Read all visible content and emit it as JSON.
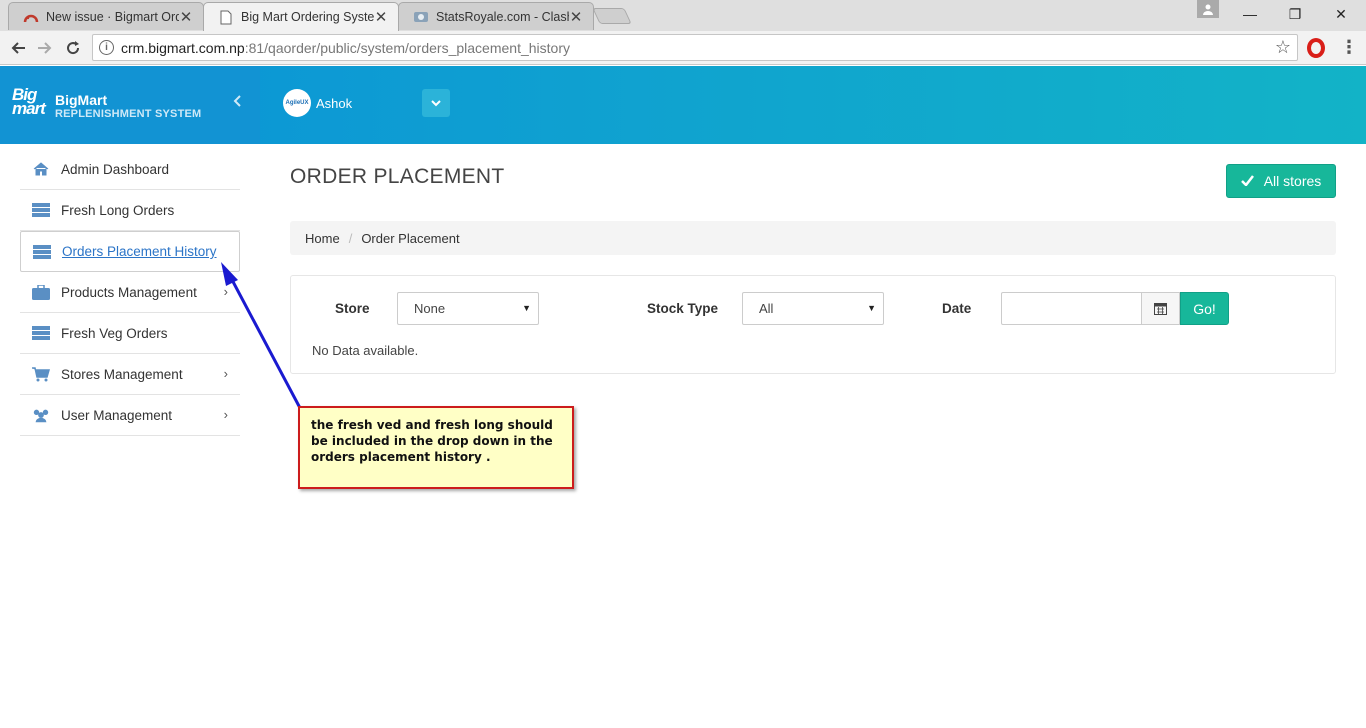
{
  "browser": {
    "tabs": [
      {
        "title": "New issue · Bigmart Orde",
        "close": "✕"
      },
      {
        "title": "Big Mart Ordering System",
        "close": "✕"
      },
      {
        "title": "StatsRoyale.com - Clash R",
        "close": "✕"
      }
    ],
    "url_host": "crm.bigmart.com.np",
    "url_path": ":81/qaorder/public/system/orders_placement_history",
    "window_controls": {
      "minimize": "—",
      "restore": "❐",
      "close": "✕"
    }
  },
  "header": {
    "logo_text": "Big mart",
    "brand_name": "BigMart",
    "brand_sub": "REPLENISHMENT SYSTEM",
    "avatar_text": "AgileUX",
    "username": "Ashok"
  },
  "sidebar": {
    "items": [
      {
        "label": "Admin Dashboard",
        "icon": "home-icon"
      },
      {
        "label": "Fresh Long Orders",
        "icon": "server-icon"
      },
      {
        "label": "Orders Placement History",
        "icon": "server-icon",
        "active": true
      },
      {
        "label": "Products Management",
        "icon": "briefcase-icon",
        "chevron": "›"
      },
      {
        "label": "Fresh Veg Orders",
        "icon": "server-icon"
      },
      {
        "label": "Stores Management",
        "icon": "cart-icon",
        "chevron": "›"
      },
      {
        "label": "User Management",
        "icon": "users-icon",
        "chevron": "›"
      }
    ]
  },
  "main": {
    "title": "ORDER PLACEMENT",
    "all_stores_label": "All stores",
    "breadcrumb": {
      "home": "Home",
      "separator": "/",
      "current": "Order Placement"
    },
    "filters": {
      "store_label": "Store",
      "store_value": "None",
      "stock_type_label": "Stock Type",
      "stock_type_value": "All",
      "date_label": "Date",
      "date_value": "",
      "go_label": "Go!"
    },
    "no_data": "No Data available."
  },
  "annotation": {
    "text": "the fresh ved and fresh long should be included in the drop down in the orders placement history ."
  },
  "colors": {
    "header_start": "#0a92d8",
    "header_end": "#12b3c7",
    "accent_teal": "#17b79a",
    "link_blue": "#2b74c7",
    "callout_bg": "#ffffc6",
    "callout_border": "#cc1c1c",
    "arrow_blue": "#1a1ad0"
  }
}
